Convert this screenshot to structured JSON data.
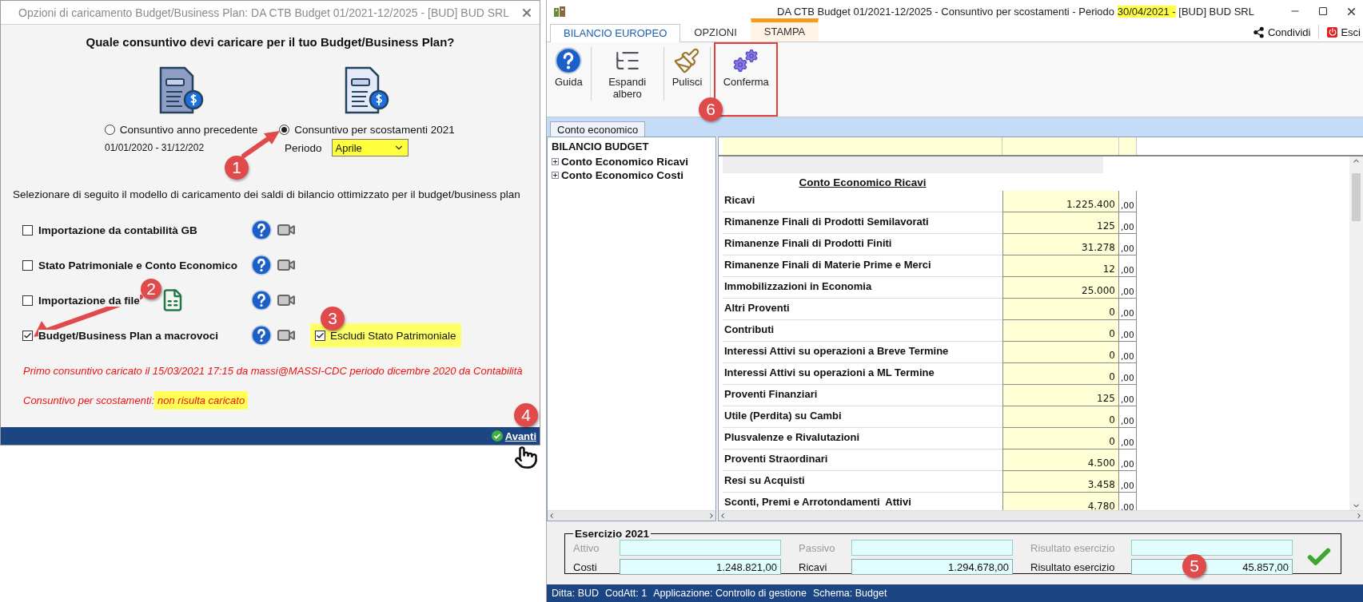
{
  "dialog": {
    "title": "Opzioni di caricamento Budget/Business Plan: DA CTB Budget 01/2021-12/2025 - [BUD] BUD SRL",
    "question": "Quale consuntivo devi caricare per il tuo Budget/Business Plan?",
    "sources": [
      {
        "label": "Consuntivo anno precedente",
        "selected": false,
        "note": "01/01/2020 - 31/12/202"
      },
      {
        "label": "Consuntivo per scostamenti 2021",
        "selected": true,
        "period_label": "Periodo",
        "period_value": "Aprile"
      }
    ],
    "instruction": "Selezionare di seguito il modello di caricamento dei saldi di bilancio ottimizzato per il budget/business plan",
    "models": [
      {
        "label": "Importazione da contabilità GB",
        "checked": false
      },
      {
        "label": "Stato Patrimoniale e Conto Economico",
        "checked": false
      },
      {
        "label": "Importazione da file",
        "checked": false,
        "excel": true
      },
      {
        "label": "Budget/Business Plan a macrovoci",
        "checked": true,
        "option": {
          "label": "Escludi Stato Patrimoniale",
          "checked": true
        }
      }
    ],
    "first_load_note": "Primo consuntivo caricato il 15/03/2021 17:15 da massi@MASSI-CDC periodo dicembre 2020 da Contabilità",
    "deviation_note": {
      "text": "Consuntivo per scostamenti:",
      "highlight": "non risulta caricato"
    },
    "next_button": "Avanti"
  },
  "app": {
    "title": {
      "before": "DA CTB Budget 01/2021-12/2025 - Consuntivo per scostamenti - Periodo",
      "highlight": "30/04/2021 -",
      "after": "[BUD] BUD SRL"
    },
    "tabs": [
      {
        "label": "BILANCIO EUROPEO",
        "selected": true,
        "contextual": false
      },
      {
        "label": "OPZIONI",
        "selected": false,
        "contextual": false
      },
      {
        "label": "STAMPA",
        "selected": false,
        "contextual": true
      }
    ],
    "share": "Condividi",
    "exit": "Esci",
    "ribbon": [
      {
        "label": "Guida",
        "kind": "help",
        "highlighted": false
      },
      {
        "label": "Espandi albero",
        "kind": "expand",
        "highlighted": false
      },
      {
        "label": "Pulisci",
        "kind": "clean",
        "highlighted": false
      },
      {
        "label": "Conferma",
        "kind": "confirm",
        "highlighted": true
      }
    ],
    "sub_tabs": [
      {
        "label": "Conto economico",
        "selected": true
      }
    ],
    "tree": {
      "label": "BILANCIO BUDGET",
      "children": [
        {
          "label": "Conto Economico Ricavi",
          "expanded": false
        },
        {
          "label": "Conto Economico Costi",
          "expanded": false
        }
      ]
    },
    "grid": {
      "section": "Conto Economico Ricavi",
      "rows": [
        {
          "label": "Ricavi",
          "value": "1.225.400",
          "decimals": ",00"
        },
        {
          "label": "Rimanenze Finali di Prodotti Semilavorati",
          "value": "125",
          "decimals": ",00"
        },
        {
          "label": "Rimanenze Finali di Prodotti Finiti",
          "value": "31.278",
          "decimals": ",00"
        },
        {
          "label": "Rimanenze Finali di Materie Prime e Merci",
          "value": "12",
          "decimals": ",00"
        },
        {
          "label": "Immobilizzazioni in Economia",
          "value": "25.000",
          "decimals": ",00"
        },
        {
          "label": "Altri Proventi",
          "value": "0",
          "decimals": ",00"
        },
        {
          "label": "Contributi",
          "value": "0",
          "decimals": ",00"
        },
        {
          "label": "Interessi Attivi su operazioni a Breve Termine",
          "value": "0",
          "decimals": ",00"
        },
        {
          "label": "Interessi Attivi su operazioni a ML Termine",
          "value": "0",
          "decimals": ",00"
        },
        {
          "label": "Proventi Finanziari",
          "value": "125",
          "decimals": ",00"
        },
        {
          "label": "Utile (Perdita) su Cambi",
          "value": "0",
          "decimals": ",00"
        },
        {
          "label": "Plusvalenze e Rivalutazioni",
          "value": "0",
          "decimals": ",00"
        },
        {
          "label": "Proventi Straordinari",
          "value": "4.500",
          "decimals": ",00"
        },
        {
          "label": "Resi su Acquisti",
          "value": "3.458",
          "decimals": ",00"
        },
        {
          "label": "Sconti, Premi e Arrotondamenti  Attivi",
          "value": "4.780",
          "decimals": ",00"
        }
      ]
    },
    "summary": {
      "title": "Esercizio 2021",
      "fields": [
        {
          "label": "Attivo",
          "disabled": true
        },
        {
          "label": "Passivo",
          "disabled": true
        },
        {
          "label": "Risultato esercizio",
          "disabled": true
        },
        {
          "label": "Costi",
          "disabled": false,
          "value": "1.248.821,00"
        },
        {
          "label": "Ricavi",
          "disabled": false,
          "value": "1.294.678,00"
        },
        {
          "label": "Risultato esercizio",
          "disabled": false,
          "value": "45.857,00"
        }
      ]
    },
    "status_bar": [
      "Ditta: BUD",
      "CodAtt: 1",
      "Applicazione: Controllo di gestione",
      "Schema: Budget"
    ]
  },
  "callouts": [
    {
      "number": "1"
    },
    {
      "number": "2"
    },
    {
      "number": "3"
    },
    {
      "number": "4"
    },
    {
      "number": "5"
    },
    {
      "number": "6"
    }
  ]
}
